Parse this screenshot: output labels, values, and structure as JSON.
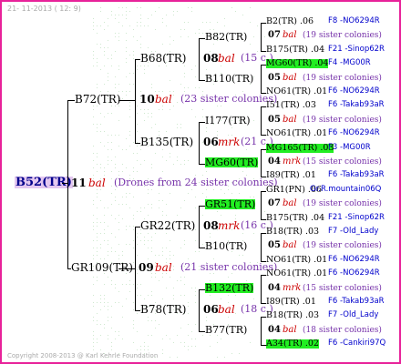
{
  "date": "21- 11-2013 ( 12:  9)",
  "copyright": "Copyright 2008-2013 @ Karl Kehrle Foundation",
  "root": {
    "id": "B52(TR)",
    "year": "11",
    "mate": "bal",
    "info": "(Drones from 24 sister colonies)"
  },
  "g1": [
    {
      "id": "B72(TR)",
      "year": "10",
      "mate": "bal",
      "info": "(23 sister colonies)"
    },
    {
      "id": "GR109(TR)",
      "year": "09",
      "mate": "bal",
      "info": "(21 sister colonies)"
    }
  ],
  "g2": [
    {
      "id": "B68(TR)",
      "year": "08",
      "mate": "bal",
      "info": "(15 c.)"
    },
    {
      "id": "B135(TR)",
      "year": "06",
      "mate": "mrk",
      "info": "(21 c.)"
    },
    {
      "id": "GR22(TR)",
      "year": "08",
      "mate": "mrk",
      "info": "(16 c.)"
    },
    {
      "id": "B78(TR)",
      "year": "06",
      "mate": "bal",
      "info": "(18 c.)"
    }
  ],
  "g3": [
    {
      "id": "B82(TR)"
    },
    {
      "id": "B110(TR)"
    },
    {
      "id": "I177(TR)"
    },
    {
      "id": "MG60(TR)"
    },
    {
      "id": "GR51(TR)"
    },
    {
      "id": "B10(TR)"
    },
    {
      "id": "B132(TR)"
    },
    {
      "id": "B77(TR)"
    }
  ],
  "g4": [
    {
      "id": "B2(TR) .06",
      "code": "F8 -NO6294R"
    },
    {
      "id": "07",
      "mate": "bal",
      "info": "(19 sister colonies)"
    },
    {
      "id": "B175(TR) .04",
      "code": "F21 -Sinop62R"
    },
    {
      "id": "MG60(TR) .04",
      "code": "F4 -MG00R"
    },
    {
      "id": "05",
      "mate": "bal",
      "info": "(19 sister colonies)"
    },
    {
      "id": "NO61(TR) .01",
      "code": "F6 -NO6294R"
    },
    {
      "id": "I51(TR) .03",
      "code": "F6 -Takab93aR"
    },
    {
      "id": "05",
      "mate": "bal",
      "info": "(19 sister colonies)"
    },
    {
      "id": "NO61(TR) .01",
      "code": "F6 -NO6294R"
    },
    {
      "id": "MG165(TR) .03",
      "code": "F3 -MG00R"
    },
    {
      "id": "04",
      "mate": "mrk",
      "info": "(15 sister colonies)"
    },
    {
      "id": "I89(TR) .01",
      "code": "F6 -Takab93aR"
    },
    {
      "id": "GR1(PN) .06",
      "code": "Gr.R.mountain06Q"
    },
    {
      "id": "07",
      "mate": "bal",
      "info": "(19 sister colonies)"
    },
    {
      "id": "B175(TR) .04",
      "code": "F21 -Sinop62R"
    },
    {
      "id": "B18(TR) .03",
      "code": "F7 -Old_Lady"
    },
    {
      "id": "05",
      "mate": "bal",
      "info": "(19 sister colonies)"
    },
    {
      "id": "NO61(TR) .01",
      "code": "F6 -NO6294R"
    },
    {
      "id": "NO61(TR) .01",
      "code": "F6 -NO6294R"
    },
    {
      "id": "04",
      "mate": "mrk",
      "info": "(15 sister colonies)"
    },
    {
      "id": "I89(TR) .01",
      "code": "F6 -Takab93aR"
    },
    {
      "id": "B18(TR) .03",
      "code": "F7 -Old_Lady"
    },
    {
      "id": "04",
      "mate": "bal",
      "info": "(18 sister colonies)"
    },
    {
      "id": "A34(TR) .02",
      "code": "F6 -Cankiri97Q"
    }
  ]
}
